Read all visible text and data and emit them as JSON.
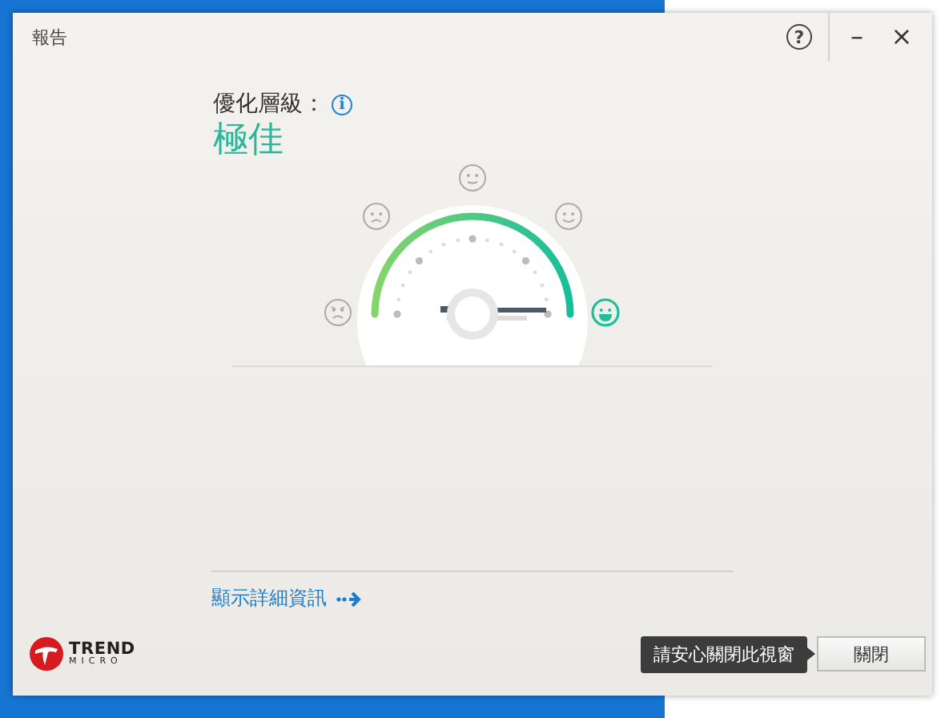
{
  "window": {
    "title": "報告",
    "help": "?",
    "minimize": "–",
    "close": "×"
  },
  "rating": {
    "label": "優化層級：",
    "info": "i",
    "value": "極佳"
  },
  "gauge": {
    "levels": [
      {
        "kind": "angry",
        "selected": false
      },
      {
        "kind": "sad",
        "selected": false
      },
      {
        "kind": "neutral",
        "selected": false
      },
      {
        "kind": "happy",
        "selected": false
      },
      {
        "kind": "grin",
        "selected": true
      }
    ]
  },
  "details_link": {
    "label": "顯示詳細資訊"
  },
  "logo": {
    "name": "TREND",
    "sub": "MICRO"
  },
  "tooltip": {
    "text": "請安心關閉此視窗"
  },
  "buttons": [
    {
      "label": "關閉"
    }
  ]
}
